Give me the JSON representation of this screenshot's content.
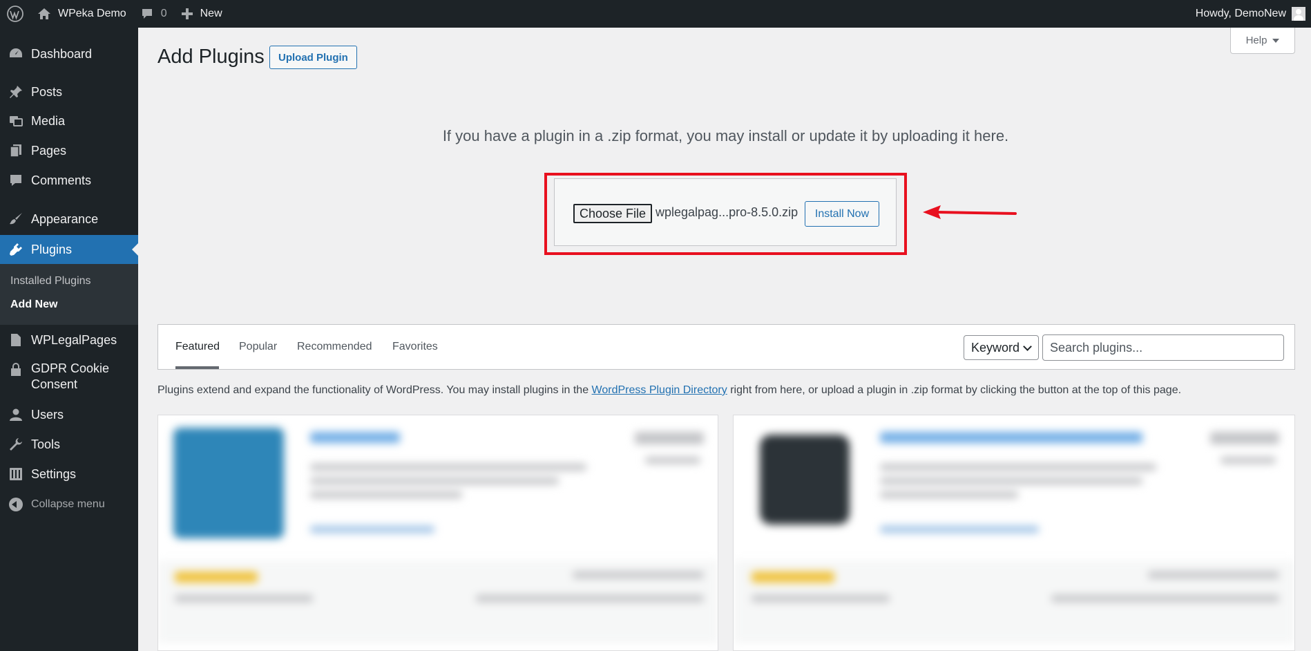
{
  "admin_bar": {
    "site_name": "WPeka Demo",
    "comments_count": "0",
    "new_label": "New",
    "greeting": "Howdy, DemoNew"
  },
  "sidebar": {
    "items": [
      {
        "label": "Dashboard",
        "icon": "dashboard-icon"
      },
      {
        "label": "Posts",
        "icon": "pin-icon"
      },
      {
        "label": "Media",
        "icon": "media-icon"
      },
      {
        "label": "Pages",
        "icon": "pages-icon"
      },
      {
        "label": "Comments",
        "icon": "comment-icon"
      },
      {
        "label": "Appearance",
        "icon": "brush-icon"
      },
      {
        "label": "Plugins",
        "icon": "plugin-icon"
      },
      {
        "label": "WPLegalPages",
        "icon": "document-icon"
      },
      {
        "label": "GDPR Cookie Consent",
        "icon": "lock-icon"
      },
      {
        "label": "Users",
        "icon": "user-icon"
      },
      {
        "label": "Tools",
        "icon": "wrench-icon"
      },
      {
        "label": "Settings",
        "icon": "settings-icon"
      }
    ],
    "plugins_submenu": [
      "Installed Plugins",
      "Add New"
    ],
    "collapse_label": "Collapse menu"
  },
  "page": {
    "title": "Add Plugins",
    "upload_button": "Upload Plugin",
    "help_label": "Help"
  },
  "upload": {
    "description": "If you have a plugin in a .zip format, you may install or update it by uploading it here.",
    "choose_file_label": "Choose File",
    "file_name": "wplegalpag...pro-8.5.0.zip",
    "install_button": "Install Now"
  },
  "filter": {
    "tabs": [
      "Featured",
      "Popular",
      "Recommended",
      "Favorites"
    ],
    "search_type": "Keyword",
    "search_placeholder": "Search plugins..."
  },
  "intro": {
    "before_link": "Plugins extend and expand the functionality of WordPress. You may install plugins in the ",
    "link_text": "WordPress Plugin Directory",
    "after_link": " right from here, or upload a plugin in .zip format by clicking the button at the top of this page."
  },
  "colors": {
    "admin_bg": "#1d2327",
    "accent": "#2271b1",
    "highlight": "#e8101f"
  }
}
